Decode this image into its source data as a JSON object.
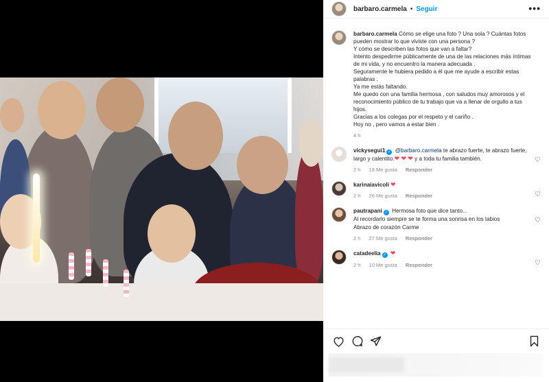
{
  "post": {
    "username": "barbaro.carmela",
    "separator": "•",
    "follow_label": "Seguir",
    "more_label": "•••"
  },
  "caption": {
    "username": "barbaro.carmela",
    "lines": [
      "Cómo se elige una foto ? Una sola ? Cuántas fotos pueden mostrar lo que viviste con una persona ?",
      "Y cómo se describen las fotos que van a faltar?",
      "Intento despedirme públicamente de una de las relaciones más íntimas de mi vida, y no encuentro la manera adecuada .",
      "Seguramente le hubiera pedido a él que me ayude a escribir estas palabras .",
      "Ya me estás faltando.",
      "Me quedo con una familia hermosa , con saludos muy amorosos y el reconocimiento público de tu trabajo que va a llenar de orgullo a tus hijos.",
      "Gracias a los colegas por el respeto y el cariño .",
      "Hoy no , pero vamos a estar bien ."
    ],
    "time": "4 h"
  },
  "comments": [
    {
      "username": "vickysegui1",
      "mention": "@barbaro.carmela",
      "text_before": " te abrazo fuerte, te abrazo fuerte, largo y calentito.",
      "text_after": " y a toda tu familia también.",
      "time": "2 h",
      "likes": "18 Me gusta",
      "reply": "Responder"
    },
    {
      "username": "karinaiavicoli",
      "time": "2 h",
      "likes": "26 Me gusta",
      "reply": "Responder"
    },
    {
      "username": "pautrapani",
      "text_line1": " Hermosa foto que dice tanto...",
      "text_line2": "Al recordarlo siempre se te forma una sonrisa en los labios",
      "text_line3": "Abrazo de corazón Carme",
      "time": "2 h",
      "likes": "27 Me gusta",
      "reply": "Responder"
    },
    {
      "username": "catadeelia",
      "time": "2 h",
      "likes": "10 Me gusta",
      "reply": "Responder"
    }
  ],
  "icons": {
    "heart": "heart-icon",
    "comment": "comment-icon",
    "share": "share-icon",
    "save": "bookmark-icon",
    "verified": "verified-badge-icon"
  },
  "colors": {
    "link": "#0095f6",
    "text": "#262626",
    "muted": "#8e8e8e",
    "heart_red": "#ed4956"
  }
}
